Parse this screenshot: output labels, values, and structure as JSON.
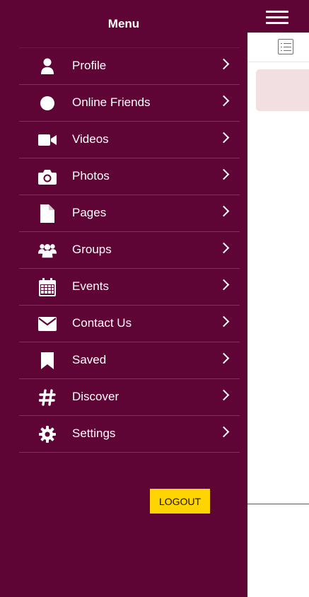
{
  "drawer": {
    "title": "Menu",
    "items": [
      {
        "label": "Profile",
        "icon": "user-icon"
      },
      {
        "label": "Online Friends",
        "icon": "circle-icon"
      },
      {
        "label": "Videos",
        "icon": "video-camera-icon"
      },
      {
        "label": "Photos",
        "icon": "camera-icon"
      },
      {
        "label": "Pages",
        "icon": "file-icon"
      },
      {
        "label": "Groups",
        "icon": "users-icon"
      },
      {
        "label": "Events",
        "icon": "calendar-icon"
      },
      {
        "label": "Contact Us",
        "icon": "envelope-icon"
      },
      {
        "label": "Saved",
        "icon": "bookmark-icon"
      },
      {
        "label": "Discover",
        "icon": "hashtag-icon"
      },
      {
        "label": "Settings",
        "icon": "gear-icon"
      }
    ],
    "logout_label": "LOGOUT"
  },
  "colors": {
    "drawer_bg": "#5e0535",
    "logout_bg": "#ffd400",
    "card_bg": "#f1dfe2"
  }
}
